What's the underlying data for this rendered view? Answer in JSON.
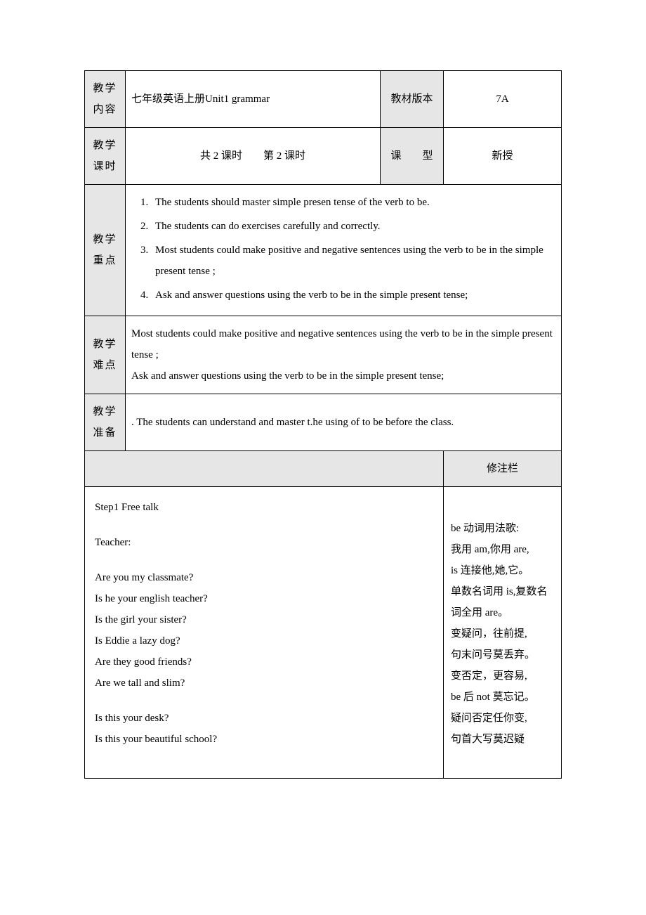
{
  "header": {
    "row1": {
      "label_content": "教学内容",
      "content": "七年级英语上册Unit1 grammar",
      "label_version": "教材版本",
      "version": "7A"
    },
    "row2": {
      "label_periods": "教学课时",
      "periods": "共 2 课时　　第 2 课时",
      "label_type": "课　　型",
      "type": "新授"
    }
  },
  "keypoints": {
    "label": "教学重点",
    "items": [
      "The students should master simple presen tense of the verb to be.",
      "The students can do exercises carefully and correctly.",
      "Most students could make positive and negative sentences using the verb to be in the simple present tense ;",
      "Ask and answer questions using the verb to be in the simple present tense;"
    ]
  },
  "difficulties": {
    "label": "教学难点",
    "text_line1": "Most students could make positive and negative sentences using the verb to be in the simple present tense ;",
    "text_line2": "Ask and answer questions using the verb to be in the simple present tense;"
  },
  "preparation": {
    "label": "教学准备",
    "text": ". The students can understand and master t.he using of to be before the class."
  },
  "notes_header": "修注栏",
  "procedure": {
    "step1_title": "Step1 Free talk",
    "teacher_label": "Teacher:",
    "q1": "Are you my classmate?",
    "q2": "Is he your english teacher?",
    "q3": "Is the girl your sister?",
    "q4": "Is Eddie a lazy dog?",
    "q5": "Are they good friends?",
    "q6": "Are we tall and slim?",
    "q7": "Is this your desk?",
    "q8": "Is this your beautiful school?"
  },
  "notes": {
    "l1": "be 动词用法歌:",
    "l2": "我用 am,你用 are,",
    "l3": "is 连接他,她,它。",
    "l4": "单数名词用 is,复数名词全用 are。",
    "l5": "变疑问，往前提,",
    "l6": "句末问号莫丢弃。",
    "l7": "变否定，更容易,",
    "l8": "be 后 not 莫忘记。",
    "l9": "疑问否定任你变,",
    "l10": "句首大写莫迟疑"
  }
}
